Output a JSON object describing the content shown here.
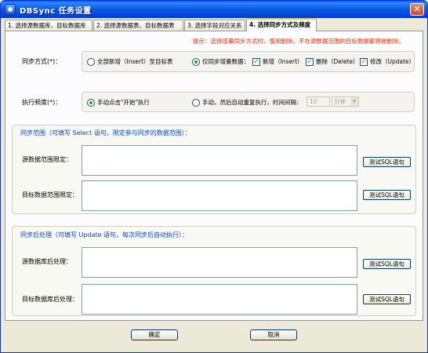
{
  "window": {
    "title": "DBSync  任务设置",
    "close_glyph": "✕"
  },
  "tabs": [
    {
      "label": "1. 选择源数据库、目标数据库",
      "active": false
    },
    {
      "label": "2. 选择源数据表、目标数据表",
      "active": false
    },
    {
      "label": "3. 选择字段对应关系",
      "active": false
    },
    {
      "label": "4. 选择同步方式及频度",
      "active": true
    }
  ],
  "hint": "提示：选择增量同步方式时，慎用删除，不在源数据范围的目标数据都将被删除。",
  "sync_mode": {
    "label": "同步方式(*)：",
    "options": [
      {
        "label": "全部新增（Insert）至目标表",
        "selected": false
      },
      {
        "label": "仅同步增量数据：",
        "selected": true
      }
    ],
    "checks": [
      {
        "label": "新增（Insert）",
        "checked": true
      },
      {
        "label": "删除（Delete）",
        "checked": true
      },
      {
        "label": "修改（Update）",
        "checked": true
      }
    ]
  },
  "frequency": {
    "label": "执行频度(*)：",
    "options": [
      {
        "label": "手动点击\"开始\"执行",
        "selected": true
      },
      {
        "label": "手动，然后自动重复执行，时间间隔：",
        "selected": false
      }
    ],
    "interval_value": "10",
    "interval_unit": "分钟"
  },
  "sync_range": {
    "title": "同步范围（可填写 Select 语句，限定参与同步的数据范围）：",
    "source_label": "源数据范围限定：",
    "target_label": "目标数据范围限定：",
    "test_button": "测试SQL语句"
  },
  "post_process": {
    "title": "同步后处理（可填写 Update 语句，每次同步后自动执行）：",
    "source_label": "源数据库后处理：",
    "target_label": "目标数据库后处理：",
    "test_button": "测试SQL语句"
  },
  "footer": {
    "ok": "确定",
    "cancel": "取消"
  },
  "colors": {
    "titlebar": "#0a58e0",
    "hint": "#ff2a00",
    "section_title": "#0046d5",
    "checked": "#21a121"
  },
  "icons": {
    "app": "dbsync-app-icon",
    "close": "close-icon"
  }
}
